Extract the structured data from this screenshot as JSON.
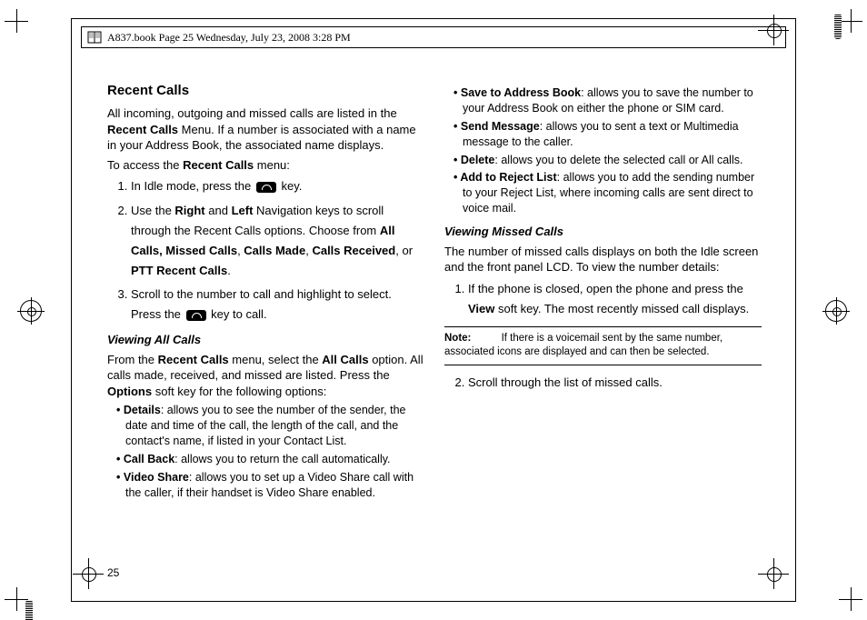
{
  "header": {
    "text": "A837.book  Page 25  Wednesday, July 23, 2008  3:28 PM"
  },
  "page_number": "25",
  "left": {
    "section_title": "Recent Calls",
    "intro_1a": "All incoming, outgoing and missed calls are listed in the ",
    "intro_1b": "Recent Calls",
    "intro_1c": " Menu. If a number is associated with a name in your Address Book, the associated name displays.",
    "intro_2a": "To access the ",
    "intro_2b": "Recent Calls",
    "intro_2c": " menu:",
    "step1a": "In Idle mode, press the ",
    "step1b": " key.",
    "step2a": "Use the ",
    "step2_right": "Right",
    "step2b": " and ",
    "step2_left": "Left",
    "step2c": " Navigation keys to scroll through the Recent Calls options. Choose from ",
    "step2_opts": "All Calls, Missed Calls",
    "step2d": ", ",
    "step2_made": "Calls Made",
    "step2e": ", ",
    "step2_recv": "Calls Received",
    "step2f": ", or ",
    "step2_ptt": "PTT Recent Calls",
    "step2g": ".",
    "step3a": "Scroll to the number to call and highlight to select. Press the ",
    "step3b": " key to call.",
    "sub1": "Viewing All Calls",
    "view_1a": "From the ",
    "view_1b": "Recent Calls",
    "view_1c": " menu, select the ",
    "view_1d": "All Calls",
    "view_1e": " option. All calls made, received, and missed are listed. Press the ",
    "view_1f": "Options",
    "view_1g": " soft key for the following options:",
    "bul_details_t": "Details",
    "bul_details": ": allows you to see the number of the sender, the date and time of the call, the length of the call, and the contact's name, if listed in your Contact List.",
    "bul_callback_t": "Call Back",
    "bul_callback": ": allows you to return the call automatically.",
    "bul_video_t": "Video Share",
    "bul_video": ": allows you to set up a Video Share call with the caller, if their handset is Video Share enabled."
  },
  "right": {
    "bul_save_t": "Save to Address Book",
    "bul_save": ": allows you to save the number to your Address Book on either the phone or SIM card.",
    "bul_send_t": "Send Message",
    "bul_send": ": allows you to sent a text or Multimedia message to the caller.",
    "bul_delete_t": "Delete",
    "bul_delete": ": allows you to delete the selected call or All calls.",
    "bul_reject_t": "Add to Reject List",
    "bul_reject": ": allows you to add the sending number to your Reject List, where incoming calls are sent direct to voice mail.",
    "sub2": "Viewing Missed Calls",
    "missed_intro": "The number of missed calls displays on both the Idle screen and the front panel LCD. To view the number details:",
    "mstep1a": "If the phone is closed, open the phone and press the ",
    "mstep1b": "View",
    "mstep1c": " soft key. The most recently missed call displays.",
    "note_label": "Note:",
    "note_body": " If there is a voicemail sent by the same number, associated icons are displayed and can then be selected.",
    "mstep2": "Scroll through the list of missed calls."
  }
}
